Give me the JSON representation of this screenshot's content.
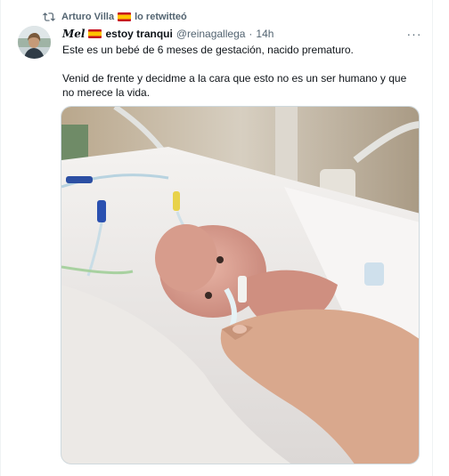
{
  "retweet": {
    "user": "Arturo Villa",
    "suffix": "lo retwitteó"
  },
  "tweet": {
    "display_name": "Mel",
    "display_name_extra": "estoy tranqui",
    "handle": "@reinagallega",
    "separator": "·",
    "time": "14h",
    "more_label": "···",
    "text_lines": [
      "Este es un bebé de 6 meses de gestación, nacido prematuro.",
      "Venid de frente y decidme a la cara que esto no es un ser humano y que no merece la vida."
    ]
  },
  "icons": {
    "retweet": "retweet-icon",
    "flag": "spain-flag-icon",
    "more": "more-options-icon"
  },
  "colors": {
    "secondary_text": "#536471",
    "border": "#cfd9de",
    "primary_text": "#0f1419"
  }
}
